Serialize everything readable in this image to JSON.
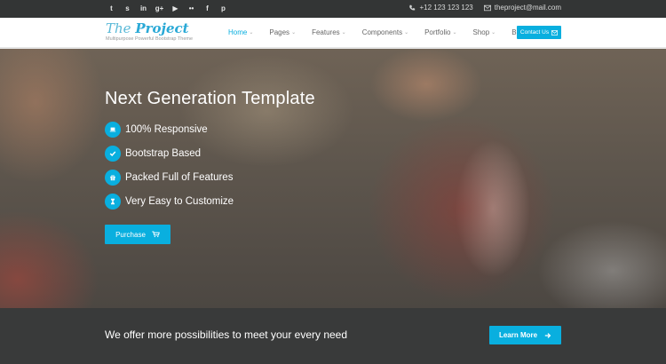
{
  "topbar": {
    "social_icons": [
      {
        "name": "twitter-icon",
        "glyph": "t"
      },
      {
        "name": "skype-icon",
        "glyph": "s"
      },
      {
        "name": "linkedin-icon",
        "glyph": "in"
      },
      {
        "name": "google-plus-icon",
        "glyph": "g+"
      },
      {
        "name": "youtube-icon",
        "glyph": "▶"
      },
      {
        "name": "flickr-icon",
        "glyph": "••"
      },
      {
        "name": "facebook-icon",
        "glyph": "f"
      },
      {
        "name": "pinterest-icon",
        "glyph": "p"
      }
    ],
    "phone": "+12 123 123 123",
    "email": "theproject@mail.com"
  },
  "header": {
    "logo_prefix": "The",
    "logo_main": "Project",
    "tagline": "Multipurpose Powerful Bootstrap Theme",
    "nav": [
      "Home",
      "Pages",
      "Features",
      "Components",
      "Portfolio",
      "Shop",
      "Blog"
    ],
    "contact_button": "Contact Us"
  },
  "hero": {
    "title": "Next Generation Template",
    "features": [
      {
        "label": "100% Responsive",
        "icon": "laptop-icon"
      },
      {
        "label": "Bootstrap Based",
        "icon": "check-icon"
      },
      {
        "label": "Packed Full of Features",
        "icon": "gift-icon"
      },
      {
        "label": "Very Easy to Customize",
        "icon": "hourglass-icon"
      }
    ],
    "purchase_button": "Purchase"
  },
  "cta": {
    "text": "We offer more possibilities to meet your every need",
    "button": "Learn More"
  },
  "colors": {
    "accent": "#09afdf",
    "topbar_bg": "#333535",
    "cta_bg": "#393a3a"
  }
}
